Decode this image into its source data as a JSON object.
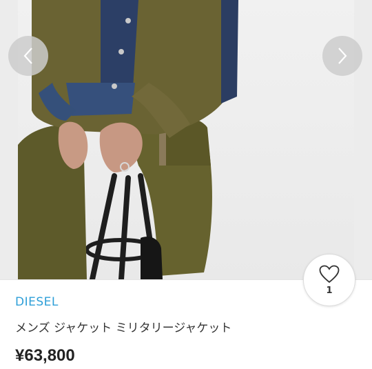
{
  "gallery": {
    "image_description_icon": "product-photo",
    "prev_icon": "chevron-left-icon",
    "next_icon": "chevron-right-icon"
  },
  "like": {
    "icon": "heart-icon",
    "count": "1"
  },
  "product": {
    "brand": "DIESEL",
    "title": "メンズ ジャケット ミリタリージャケット",
    "price": "¥63,800"
  },
  "colors": {
    "brand_link": "#2e9fd8",
    "text": "#333333",
    "price": "#222222"
  }
}
